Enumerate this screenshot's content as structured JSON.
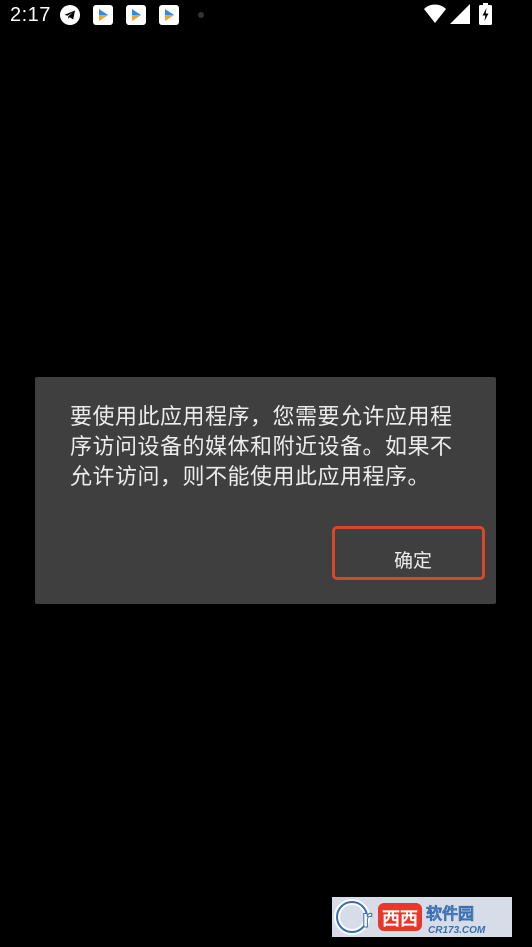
{
  "status_bar": {
    "time": "2:17",
    "icons": [
      "telegram-icon",
      "app-notification-icon",
      "app-notification-icon",
      "app-notification-icon",
      "more-dot-icon",
      "wifi-icon",
      "signal-icon",
      "battery-charging-icon"
    ]
  },
  "dialog": {
    "message": "要使用此应用程序，您需要允许应用程序访问设备的媒体和附近设备。如果不允许访问，则不能使用此应用程序。",
    "confirm_label": "确定"
  },
  "watermark": {
    "brand": "西西软件园",
    "site": "CR173.COM"
  },
  "colors": {
    "background": "#000000",
    "dialog_bg": "#3f3f3f",
    "text": "#ececec",
    "highlight": "#d9472b"
  }
}
